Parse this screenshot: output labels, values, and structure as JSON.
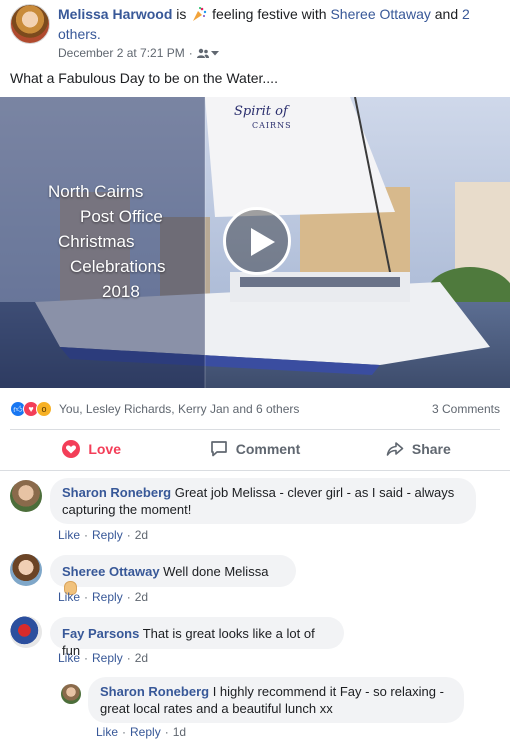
{
  "post": {
    "author": "Melissa Harwood",
    "activity_is": "is",
    "activity_feeling": "feeling festive with",
    "tagged": "Sheree Ottaway",
    "and_word": "and",
    "others": "2 others.",
    "timestamp": "December 2 at 7:21 PM",
    "separator": "·",
    "caption": "What a Fabulous Day to be on the Water...."
  },
  "video": {
    "overlay_lines": [
      "North Cairns",
      "Post Office",
      "Christmas",
      "Celebrations",
      "2018"
    ],
    "brand_line1": "Spirit of",
    "brand_line2": "CAIRNS"
  },
  "reactions": {
    "icons": [
      "like-icon",
      "love-icon",
      "wow-icon"
    ],
    "names": "You, Lesley Richards, Kerry Jan and 6 others",
    "comments_count": "3 Comments"
  },
  "actions": {
    "love_label": "Love",
    "comment_label": "Comment",
    "share_label": "Share"
  },
  "comments": [
    {
      "author": "Sharon Roneberg",
      "text_line1": "Great job Melissa - clever girl - as I said - always",
      "text_line2": "capturing the moment!",
      "like": "Like",
      "reply": "Reply",
      "age": "2d",
      "dot": "·"
    },
    {
      "author": "Sheree Ottaway",
      "text_line1": "Well done Melissa",
      "like": "Like",
      "reply": "Reply",
      "age": "2d",
      "dot": "·"
    },
    {
      "author": "Fay Parsons",
      "text_line1": "That is great looks like a lot of fun",
      "like": "Like",
      "reply": "Reply",
      "age": "2d",
      "dot": "·"
    },
    {
      "author": "Sharon Roneberg",
      "text_line1": "I highly recommend it Fay - so relaxing -",
      "text_line2": "great local rates and a beautiful lunch xx",
      "like": "Like",
      "reply": "Reply",
      "age": "1d",
      "dot": "·"
    }
  ],
  "colors": {
    "link_blue": "#385898",
    "love_red": "#f33e58",
    "bubble_grey": "#f2f3f5",
    "meta_grey": "#606770"
  }
}
